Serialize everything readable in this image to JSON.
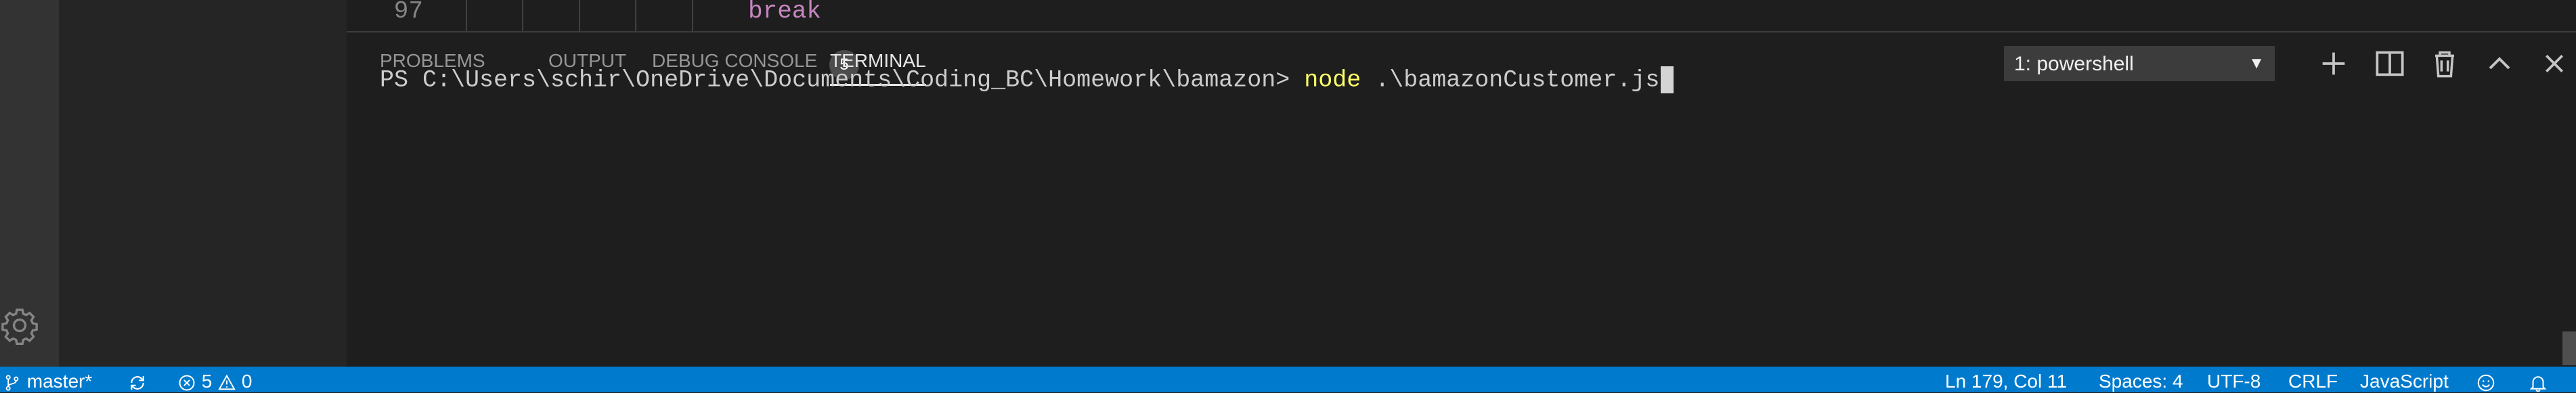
{
  "editor": {
    "line_number": "97",
    "code_text": "break"
  },
  "panel": {
    "tabs": [
      {
        "label": "PROBLEMS",
        "badge": "5"
      },
      {
        "label": "OUTPUT"
      },
      {
        "label": "DEBUG CONSOLE"
      },
      {
        "label": "TERMINAL",
        "active": true
      }
    ],
    "terminal_select": {
      "value": "1: powershell",
      "arrow": "▼"
    }
  },
  "terminal": {
    "prompt": "PS C:\\Users\\schir\\OneDrive\\Documents\\Coding_BC\\Homework\\bamazon> ",
    "command": "node",
    "argument": " .\\bamazonCustomer.js"
  },
  "statusbar": {
    "branch": "master*",
    "errors": "5",
    "warnings": "0",
    "position": "Ln 179, Col 11",
    "spaces": "Spaces: 4",
    "encoding": "UTF-8",
    "eol": "CRLF",
    "language": "JavaScript"
  },
  "colors": {
    "status_bar": "#007acc",
    "command_yellow": "#ffff66",
    "keyword_purple": "#c586c0"
  },
  "icons": [
    "settings-gear-icon",
    "new-terminal-icon",
    "split-terminal-icon",
    "kill-terminal-icon",
    "maximize-panel-icon",
    "close-panel-icon",
    "git-branch-icon",
    "sync-icon",
    "error-icon",
    "warning-icon",
    "feedback-smiley-icon",
    "notification-bell-icon"
  ]
}
